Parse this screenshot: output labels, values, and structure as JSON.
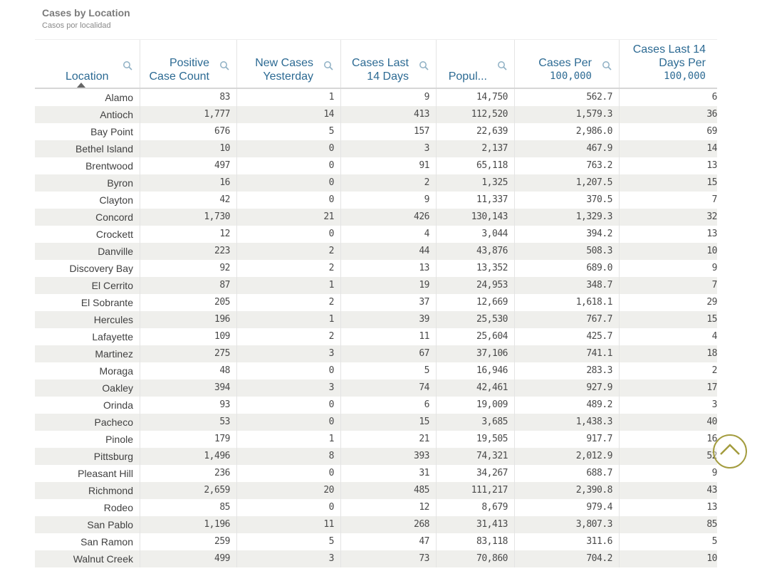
{
  "header": {
    "title": "Cases by Location",
    "subtitle": "Casos por localidad"
  },
  "colors": {
    "header_text": "#2c6a93",
    "alt_row": "#efefec",
    "scroll_button": "#a39c3e"
  },
  "columns": [
    {
      "label": [
        "Location"
      ],
      "search_icon": "search-icon",
      "sorted": "ascending"
    },
    {
      "label": [
        "Positive",
        "Case Count"
      ],
      "search_icon": "search-icon"
    },
    {
      "label": [
        "New Cases",
        "Yesterday"
      ],
      "search_icon": "search-icon"
    },
    {
      "label": [
        "Cases Last",
        "14 Days"
      ],
      "search_icon": "search-icon"
    },
    {
      "label": [
        "Popul..."
      ],
      "search_icon": "search-icon"
    },
    {
      "label": [
        "Cases Per",
        "100,000"
      ],
      "search_icon": "search-icon"
    },
    {
      "label": [
        "Cases Last 14",
        "Days Per",
        "100,000"
      ]
    }
  ],
  "rows": [
    [
      "Alamo",
      "83",
      "1",
      "9",
      "14,750",
      "562.7",
      "6"
    ],
    [
      "Antioch",
      "1,777",
      "14",
      "413",
      "112,520",
      "1,579.3",
      "36"
    ],
    [
      "Bay Point",
      "676",
      "5",
      "157",
      "22,639",
      "2,986.0",
      "69"
    ],
    [
      "Bethel Island",
      "10",
      "0",
      "3",
      "2,137",
      "467.9",
      "14"
    ],
    [
      "Brentwood",
      "497",
      "0",
      "91",
      "65,118",
      "763.2",
      "13"
    ],
    [
      "Byron",
      "16",
      "0",
      "2",
      "1,325",
      "1,207.5",
      "15"
    ],
    [
      "Clayton",
      "42",
      "0",
      "9",
      "11,337",
      "370.5",
      "7"
    ],
    [
      "Concord",
      "1,730",
      "21",
      "426",
      "130,143",
      "1,329.3",
      "32"
    ],
    [
      "Crockett",
      "12",
      "0",
      "4",
      "3,044",
      "394.2",
      "13"
    ],
    [
      "Danville",
      "223",
      "2",
      "44",
      "43,876",
      "508.3",
      "10"
    ],
    [
      "Discovery Bay",
      "92",
      "2",
      "13",
      "13,352",
      "689.0",
      "9"
    ],
    [
      "El Cerrito",
      "87",
      "1",
      "19",
      "24,953",
      "348.7",
      "7"
    ],
    [
      "El Sobrante",
      "205",
      "2",
      "37",
      "12,669",
      "1,618.1",
      "29"
    ],
    [
      "Hercules",
      "196",
      "1",
      "39",
      "25,530",
      "767.7",
      "15"
    ],
    [
      "Lafayette",
      "109",
      "2",
      "11",
      "25,604",
      "425.7",
      "4"
    ],
    [
      "Martinez",
      "275",
      "3",
      "67",
      "37,106",
      "741.1",
      "18"
    ],
    [
      "Moraga",
      "48",
      "0",
      "5",
      "16,946",
      "283.3",
      "2"
    ],
    [
      "Oakley",
      "394",
      "3",
      "74",
      "42,461",
      "927.9",
      "17"
    ],
    [
      "Orinda",
      "93",
      "0",
      "6",
      "19,009",
      "489.2",
      "3"
    ],
    [
      "Pacheco",
      "53",
      "0",
      "15",
      "3,685",
      "1,438.3",
      "40"
    ],
    [
      "Pinole",
      "179",
      "1",
      "21",
      "19,505",
      "917.7",
      "16"
    ],
    [
      "Pittsburg",
      "1,496",
      "8",
      "393",
      "74,321",
      "2,012.9",
      "52"
    ],
    [
      "Pleasant Hill",
      "236",
      "0",
      "31",
      "34,267",
      "688.7",
      "9"
    ],
    [
      "Richmond",
      "2,659",
      "20",
      "485",
      "111,217",
      "2,390.8",
      "43"
    ],
    [
      "Rodeo",
      "85",
      "0",
      "12",
      "8,679",
      "979.4",
      "13"
    ],
    [
      "San Pablo",
      "1,196",
      "11",
      "268",
      "31,413",
      "3,807.3",
      "85"
    ],
    [
      "San Ramon",
      "259",
      "5",
      "47",
      "83,118",
      "311.6",
      "5"
    ],
    [
      "Walnut Creek",
      "499",
      "3",
      "73",
      "70,860",
      "704.2",
      "10"
    ]
  ],
  "scroll_top_button": {
    "icon": "chevron-up-icon"
  }
}
